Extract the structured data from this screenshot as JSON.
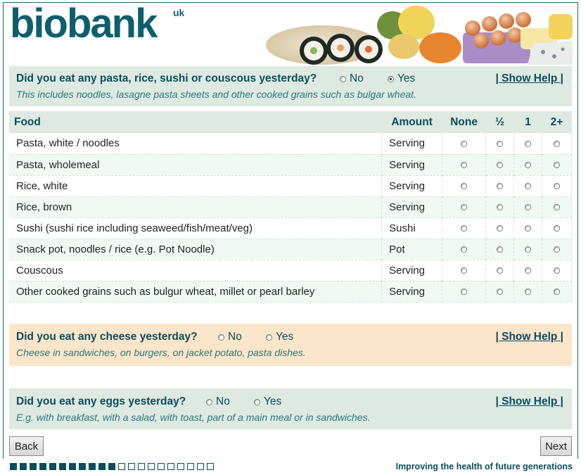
{
  "brand": {
    "logo_text": "biobank",
    "logo_suffix": "uk"
  },
  "questions": [
    {
      "text": "Did you eat any pasta, rice, sushi or couscous yesterday?",
      "no_label": "No",
      "yes_label": "Yes",
      "selected": "Yes",
      "help_label": "| Show Help |",
      "note": "This includes noodles, lasagne pasta sheets and other cooked grains such as bulgar wheat."
    },
    {
      "text": "Did you eat any cheese yesterday?",
      "no_label": "No",
      "yes_label": "Yes",
      "selected": null,
      "help_label": "| Show Help |",
      "note": "Cheese in sandwiches, on burgers, on jacket potato, pasta dishes."
    },
    {
      "text": "Did you eat any eggs yesterday?",
      "no_label": "No",
      "yes_label": "Yes",
      "selected": null,
      "help_label": "| Show Help |",
      "note": "E.g. with breakfast, with a salad, with toast, part of a main meal or in sandwiches."
    }
  ],
  "table": {
    "headers": [
      "Food",
      "Amount",
      "None",
      "½",
      "1",
      "2+"
    ],
    "rows": [
      {
        "food": "Pasta, white / noodles",
        "amount": "Serving"
      },
      {
        "food": "Pasta, wholemeal",
        "amount": "Serving"
      },
      {
        "food": "Rice, white",
        "amount": "Serving"
      },
      {
        "food": "Rice, brown",
        "amount": "Serving"
      },
      {
        "food": "Sushi (sushi rice including seaweed/fish/meat/veg)",
        "amount": "Sushi"
      },
      {
        "food": "Snack pot, noodles / rice (e.g. Pot Noodle)",
        "amount": "Pot"
      },
      {
        "food": "Couscous",
        "amount": "Serving"
      },
      {
        "food": "Other cooked grains such as bulgur wheat, millet or pearl barley",
        "amount": "Serving"
      }
    ]
  },
  "nav": {
    "back_label": "Back",
    "next_label": "Next"
  },
  "footer": {
    "tagline": "Improving the health of future generations",
    "progress_done": 11,
    "progress_total": 21
  },
  "colors": {
    "brand": "#0b4d5c",
    "section_green": "#dde9e1",
    "section_peach": "#fbe6cc"
  }
}
